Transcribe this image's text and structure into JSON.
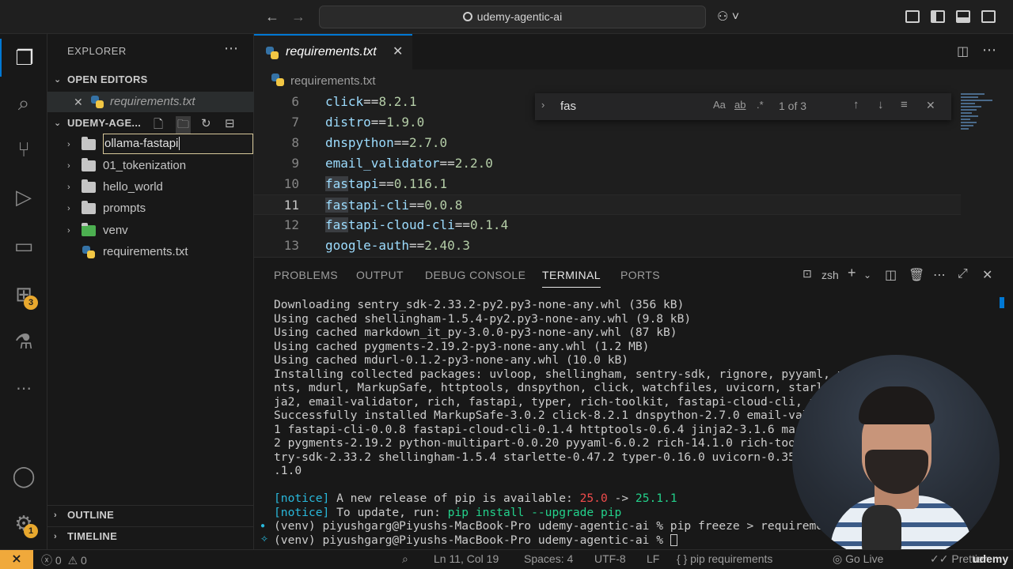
{
  "titlebar": {
    "search_text": "udemy-agentic-ai"
  },
  "activity": {
    "extensions_badge": "3",
    "accounts_badge": "1"
  },
  "sidebar": {
    "title": "EXPLORER",
    "open_editors_label": "OPEN EDITORS",
    "open_editor_file": "requirements.txt",
    "workspace_label": "UDEMY-AGE...",
    "rename_value": "ollama-fastapi",
    "tree": [
      {
        "type": "folder",
        "label": "01_tokenization"
      },
      {
        "type": "folder",
        "label": "hello_world"
      },
      {
        "type": "folder",
        "label": "prompts"
      },
      {
        "type": "folder",
        "label": "venv"
      },
      {
        "type": "file",
        "label": "requirements.txt"
      }
    ],
    "outline_label": "OUTLINE",
    "timeline_label": "TIMELINE"
  },
  "editor": {
    "tab_label": "requirements.txt",
    "breadcrumb": "requirements.txt",
    "lines": [
      {
        "num": "6",
        "pkg": "click",
        "op": "==",
        "ver": "8.2.1"
      },
      {
        "num": "7",
        "pkg": "distro",
        "op": "==",
        "ver": "1.9.0"
      },
      {
        "num": "8",
        "pkg": "dnspython",
        "op": "==",
        "ver": "2.7.0"
      },
      {
        "num": "9",
        "pkg": "email_validator",
        "op": "==",
        "ver": "2.2.0"
      },
      {
        "num": "10",
        "pkg_hl": "fas",
        "pkg": "tapi",
        "op": "==",
        "ver": "0.116.1"
      },
      {
        "num": "11",
        "pkg_hl": "fas",
        "pkg": "tapi-cli",
        "op": "==",
        "ver": "0.0.8"
      },
      {
        "num": "12",
        "pkg_hl": "fas",
        "pkg": "tapi-cloud-cli",
        "op": "==",
        "ver": "0.1.4"
      },
      {
        "num": "13",
        "pkg": "google-auth",
        "op": "==",
        "ver": "2.40.3"
      }
    ],
    "find": {
      "query": "fas",
      "match_case": "Aa",
      "whole_word": "ab",
      "regex": ".*",
      "count": "1 of 3"
    }
  },
  "panel": {
    "tabs": [
      "PROBLEMS",
      "OUTPUT",
      "DEBUG CONSOLE",
      "TERMINAL",
      "PORTS"
    ],
    "active_tab": "TERMINAL",
    "shell": "zsh",
    "terminal": [
      "Downloading sentry_sdk-2.33.2-py2.py3-none-any.whl (356 kB)",
      "Using cached shellingham-1.5.4-py2.py3-none-any.whl (9.8 kB)",
      "Using cached markdown_it_py-3.0.0-py3-none-any.whl (87 kB)",
      "Using cached pygments-2.19.2-py3-none-any.whl (1.2 MB)",
      "Using cached mdurl-0.1.2-py3-none-any.whl (10.0 kB)",
      "Installing collected packages: uvloop, shellingham, sentry-sdk, rignore, pyyaml, p",
      "nts, mdurl, MarkupSafe, httptools, dnspython, click, watchfiles, uvicorn, starl",
      "ja2, email-validator, rich, fastapi, typer, rich-toolkit, fastapi-cloud-cli, f",
      "Successfully installed MarkupSafe-3.0.2 click-8.2.1 dnspython-2.7.0 email-val",
      "1 fastapi-cli-0.0.8 fastapi-cloud-cli-0.1.4 httptools-0.6.4 jinja2-3.1.6 mar",
      "2 pygments-2.19.2 python-multipart-0.0.20 pyyaml-6.0.2 rich-14.1.0 rich-too",
      "try-sdk-2.33.2 shellingham-1.5.4 starlette-0.47.2 typer-0.16.0 uvicorn-0.35",
      ".1.0"
    ],
    "notice1_prefix": "[notice]",
    "notice1_text": " A new release of pip is available: ",
    "notice1_old": "25.0",
    "notice1_arrow": " -> ",
    "notice1_new": "25.1.1",
    "notice2_prefix": "[notice]",
    "notice2_text": " To update, run: ",
    "notice2_cmd": "pip install --upgrade pip",
    "prompt1": "(venv) piyushgarg@Piyushs-MacBook-Pro udemy-agentic-ai % pip freeze > requireme",
    "prompt2": "(venv) piyushgarg@Piyushs-MacBook-Pro udemy-agentic-ai % "
  },
  "statusbar": {
    "errors": "0",
    "warnings": "0",
    "position": "Ln 11, Col 19",
    "spaces": "Spaces: 4",
    "encoding": "UTF-8",
    "eol": "LF",
    "language": "pip requirements",
    "golive": "Go Live",
    "prettier": "Prettier",
    "watermark": "udemy"
  },
  "colors": {
    "accent": "#0078d4",
    "remote": "#f0a93b",
    "badge": "#e8a82e"
  }
}
